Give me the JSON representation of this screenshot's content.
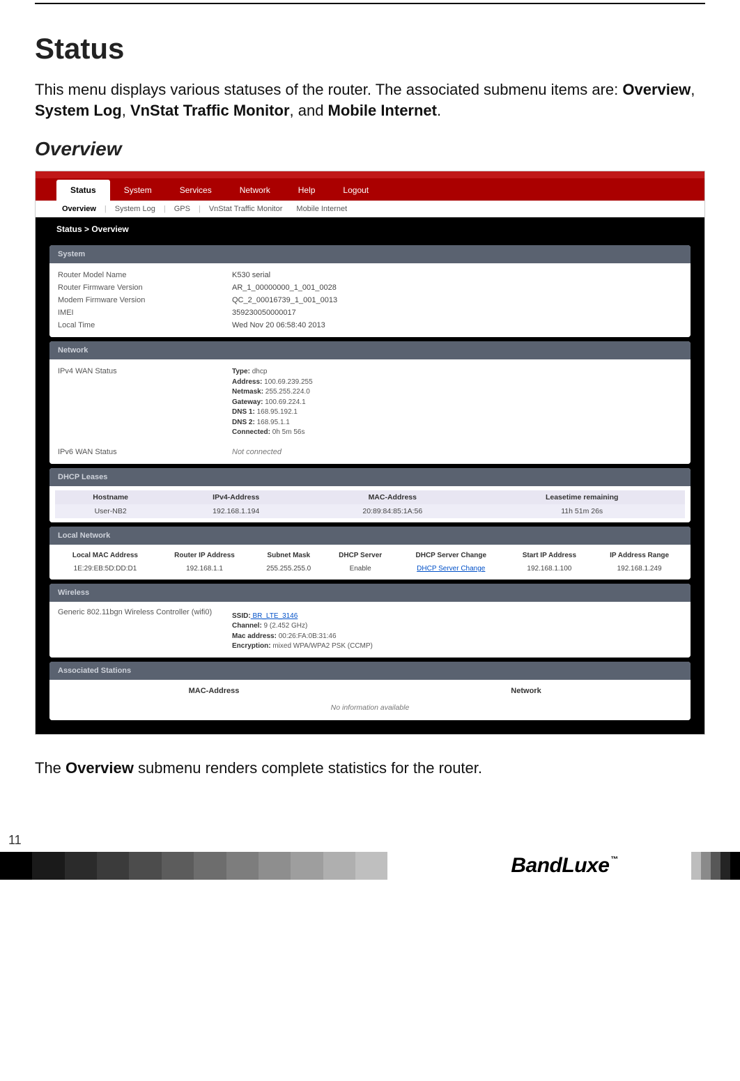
{
  "doc": {
    "title": "Status",
    "intro_pre": "This menu displays various statuses of the router. The associated submenu items are: ",
    "intro_b1": "Overview",
    "intro_s1": ", ",
    "intro_b2": "System Log",
    "intro_s2": ", ",
    "intro_b3": "VnStat Traffic Monitor",
    "intro_s3": ", and ",
    "intro_b4": "Mobile Internet",
    "intro_s4": ".",
    "section": "Overview",
    "after_pre": "The ",
    "after_b": "Overview",
    "after_post": " submenu renders complete statistics for the router.",
    "page_number": "11",
    "brand": "BandLuxe",
    "tm": "™"
  },
  "ui": {
    "tabs": {
      "status": "Status",
      "system": "System",
      "services": "Services",
      "network": "Network",
      "help": "Help",
      "logout": "Logout"
    },
    "subnav": {
      "overview": "Overview",
      "system_log": "System Log",
      "gps": "GPS",
      "vnstat": "VnStat Traffic Monitor",
      "mobile": "Mobile Internet"
    },
    "crumb": "Status > Overview",
    "panels": {
      "system": {
        "title": "System",
        "rows": {
          "model_l": "Router Model Name",
          "model_v": "K530 serial",
          "fw_l": "Router Firmware Version",
          "fw_v": "AR_1_00000000_1_001_0028",
          "mfw_l": "Modem Firmware Version",
          "mfw_v": "QC_2_00016739_1_001_0013",
          "imei_l": "IMEI",
          "imei_v": "359230050000017",
          "time_l": "Local Time",
          "time_v": "Wed Nov 20 06:58:40 2013"
        }
      },
      "network": {
        "title": "Network",
        "ipv4_l": "IPv4 WAN Status",
        "ipv6_l": "IPv6 WAN Status",
        "ipv6_v": "Not connected",
        "type_l": "Type:",
        "type_v": " dhcp",
        "addr_l": "Address:",
        "addr_v": " 100.69.239.255",
        "mask_l": "Netmask:",
        "mask_v": " 255.255.224.0",
        "gw_l": "Gateway:",
        "gw_v": " 100.69.224.1",
        "dns1_l": "DNS 1:",
        "dns1_v": " 168.95.192.1",
        "dns2_l": "DNS 2:",
        "dns2_v": " 168.95.1.1",
        "conn_l": "Connected:",
        "conn_v": " 0h 5m 56s"
      },
      "dhcp": {
        "title": "DHCP Leases",
        "h_host": "Hostname",
        "h_ip": "IPv4-Address",
        "h_mac": "MAC-Address",
        "h_lease": "Leasetime remaining",
        "r_host": "User-NB2",
        "r_ip": "192.168.1.194",
        "r_mac": "20:89:84:85:1A:56",
        "r_lease": "11h 51m 26s"
      },
      "local": {
        "title": "Local Network",
        "h_mac": "Local MAC Address",
        "h_rip": "Router IP Address",
        "h_mask": "Subnet Mask",
        "h_dhcp": "DHCP Server",
        "h_chg": "DHCP Server Change",
        "h_start": "Start IP Address",
        "h_range": "IP Address Range",
        "r_mac": "1E:29:EB:5D:DD:D1",
        "r_rip": "192.168.1.1",
        "r_mask": "255.255.255.0",
        "r_dhcp": "Enable",
        "r_chg": "DHCP Server Change",
        "r_start": "192.168.1.100",
        "r_range": "192.168.1.249"
      },
      "wireless": {
        "title": "Wireless",
        "ctrl": "Generic 802.11bgn Wireless Controller (wifi0)",
        "ssid_l": "SSID:",
        "ssid_v": " BR_LTE_3146",
        "ch_l": "Channel:",
        "ch_v": " 9 (2.452 GHz)",
        "wmac_l": "Mac address:",
        "wmac_v": " 00:26:FA:0B:31:46",
        "enc_l": "Encryption:",
        "enc_v": " mixed WPA/WPA2 PSK (CCMP)"
      },
      "assoc": {
        "title": "Associated Stations",
        "h_mac": "MAC-Address",
        "h_net": "Network",
        "empty": "No information available"
      }
    }
  },
  "grad_colors": [
    "#000000",
    "#1a1a1a",
    "#2b2b2b",
    "#3b3b3b",
    "#4c4c4c",
    "#5c5c5c",
    "#6d6d6d",
    "#7d7d7d",
    "#8e8e8e",
    "#9e9e9e",
    "#afafaf",
    "#bfbfbf"
  ]
}
